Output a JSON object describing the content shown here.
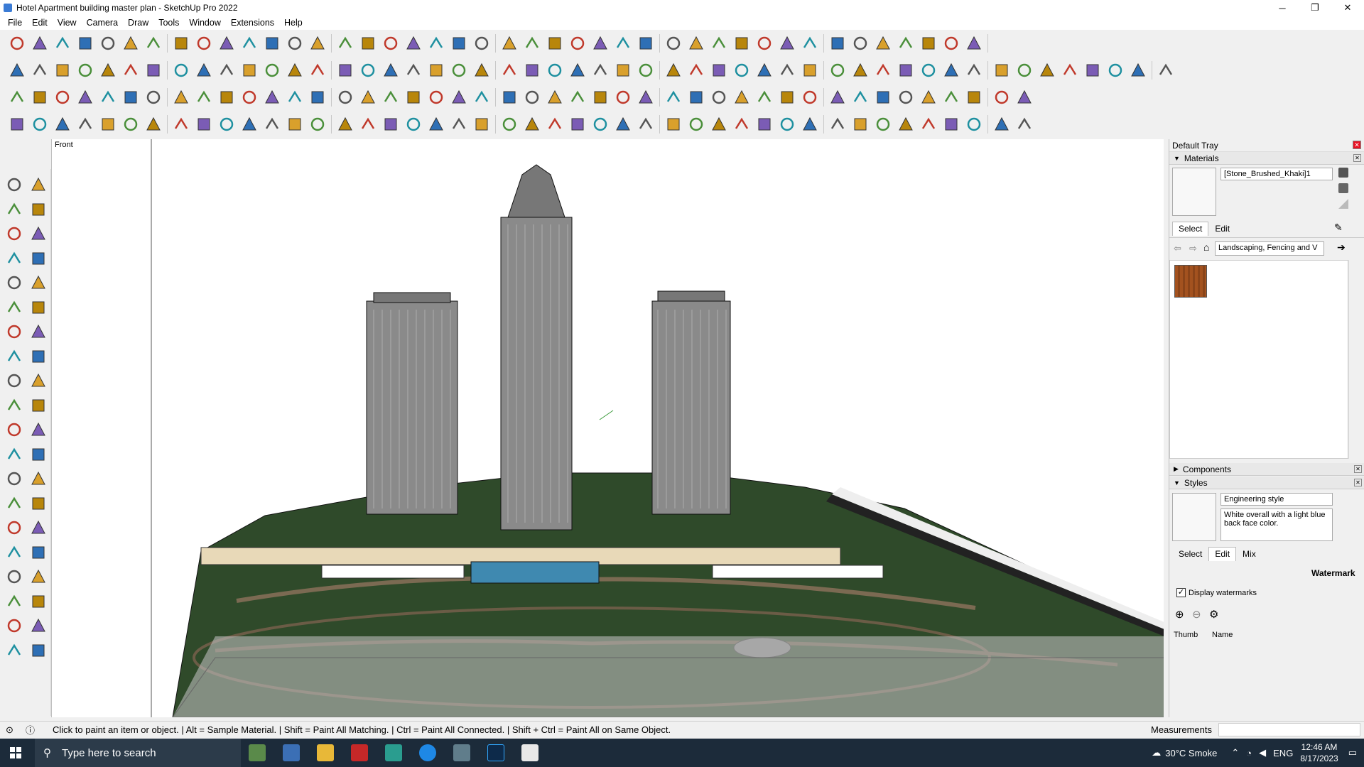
{
  "window": {
    "title": "Hotel Apartment building master plan - SketchUp Pro 2022",
    "minimize": "─",
    "restore": "❐",
    "close": "✕"
  },
  "menu": [
    "File",
    "Edit",
    "View",
    "Camera",
    "Draw",
    "Tools",
    "Window",
    "Extensions",
    "Help"
  ],
  "viewport": {
    "scene_label": "Front"
  },
  "tray": {
    "title": "Default Tray",
    "materials": {
      "header": "Materials",
      "name": "[Stone_Brushed_Khaki]1",
      "tab_select": "Select",
      "tab_edit": "Edit",
      "library": "Landscaping, Fencing and V"
    },
    "components": {
      "header": "Components"
    },
    "styles": {
      "header": "Styles",
      "name": "Engineering style",
      "description": "White overall with a light blue back face color.",
      "tab_select": "Select",
      "tab_edit": "Edit",
      "tab_mix": "Mix",
      "section": "Watermark",
      "checkbox": "Display watermarks",
      "col_thumb": "Thumb",
      "col_name": "Name"
    }
  },
  "status": {
    "message": "Click to paint an item or object. | Alt = Sample Material. | Shift = Paint All Matching. | Ctrl = Paint All Connected. | Shift + Ctrl = Paint All on Same Object.",
    "measurements_label": "Measurements"
  },
  "taskbar": {
    "search_placeholder": "Type here to search",
    "weather": "30°C  Smoke",
    "lang": "ENG",
    "time": "12:46 AM",
    "date": "8/17/2023"
  },
  "colors": {
    "titlebar": "#ffffff",
    "toolbar": "#f0f0f0",
    "taskbar": "#1c2b3a",
    "grass": "#2f4a2a"
  }
}
